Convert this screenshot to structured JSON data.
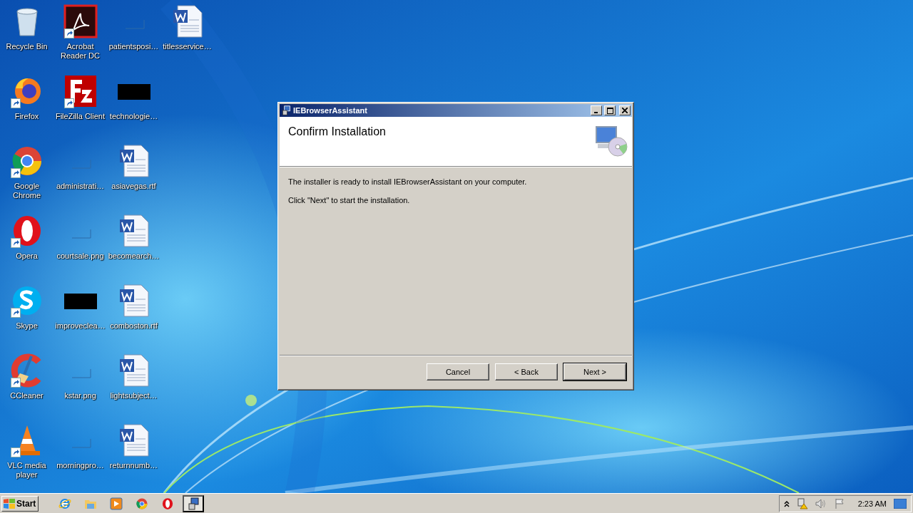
{
  "desktop_icons": [
    {
      "label": "Recycle Bin",
      "kind": "recycle",
      "shortcut": false
    },
    {
      "label": "Firefox",
      "kind": "firefox",
      "shortcut": true
    },
    {
      "label": "Google Chrome",
      "kind": "chrome",
      "shortcut": true
    },
    {
      "label": "Opera",
      "kind": "opera",
      "shortcut": true
    },
    {
      "label": "Skype",
      "kind": "skype",
      "shortcut": true
    },
    {
      "label": "CCleaner",
      "kind": "ccleaner",
      "shortcut": true
    },
    {
      "label": "VLC media player",
      "kind": "vlc",
      "shortcut": true
    },
    {
      "label": "Acrobat Reader DC",
      "kind": "acrobat",
      "shortcut": true
    },
    {
      "label": "FileZilla Client",
      "kind": "filezilla",
      "shortcut": true
    },
    {
      "label": "administrati…",
      "kind": "blank",
      "shortcut": false
    },
    {
      "label": "courtsale.png",
      "kind": "blank",
      "shortcut": false
    },
    {
      "label": "improveclea…",
      "kind": "black",
      "shortcut": false
    },
    {
      "label": "kstar.png",
      "kind": "blank",
      "shortcut": false
    },
    {
      "label": "morningpro…",
      "kind": "blank",
      "shortcut": false
    },
    {
      "label": "patientsposi…",
      "kind": "blank",
      "shortcut": false
    },
    {
      "label": "technologie…",
      "kind": "black",
      "shortcut": false
    },
    {
      "label": "asiavegas.rtf",
      "kind": "word",
      "shortcut": false
    },
    {
      "label": "becomearch…",
      "kind": "word",
      "shortcut": false
    },
    {
      "label": "comboston.rtf",
      "kind": "word",
      "shortcut": false
    },
    {
      "label": "lightsubject…",
      "kind": "word",
      "shortcut": false
    },
    {
      "label": "returnnumb…",
      "kind": "word",
      "shortcut": false
    },
    {
      "label": "titlesservice…",
      "kind": "word",
      "shortcut": false
    }
  ],
  "dialog": {
    "title": "IEBrowserAssistant",
    "heading": "Confirm Installation",
    "messages": [
      "The installer is ready to install IEBrowserAssistant on your computer.",
      "Click \"Next\" to start the installation."
    ],
    "buttons": [
      {
        "label": "Cancel",
        "default": false
      },
      {
        "label": "< Back",
        "default": false
      },
      {
        "label": "Next >",
        "default": true
      }
    ]
  },
  "taskbar": {
    "start": "Start",
    "items": [
      {
        "kind": "ie",
        "selected": false
      },
      {
        "kind": "explorer",
        "selected": false
      },
      {
        "kind": "player",
        "selected": false
      },
      {
        "kind": "chrome",
        "selected": false
      },
      {
        "kind": "opera",
        "selected": false
      },
      {
        "kind": "installer",
        "selected": true
      }
    ],
    "clock": "2:23 AM"
  }
}
